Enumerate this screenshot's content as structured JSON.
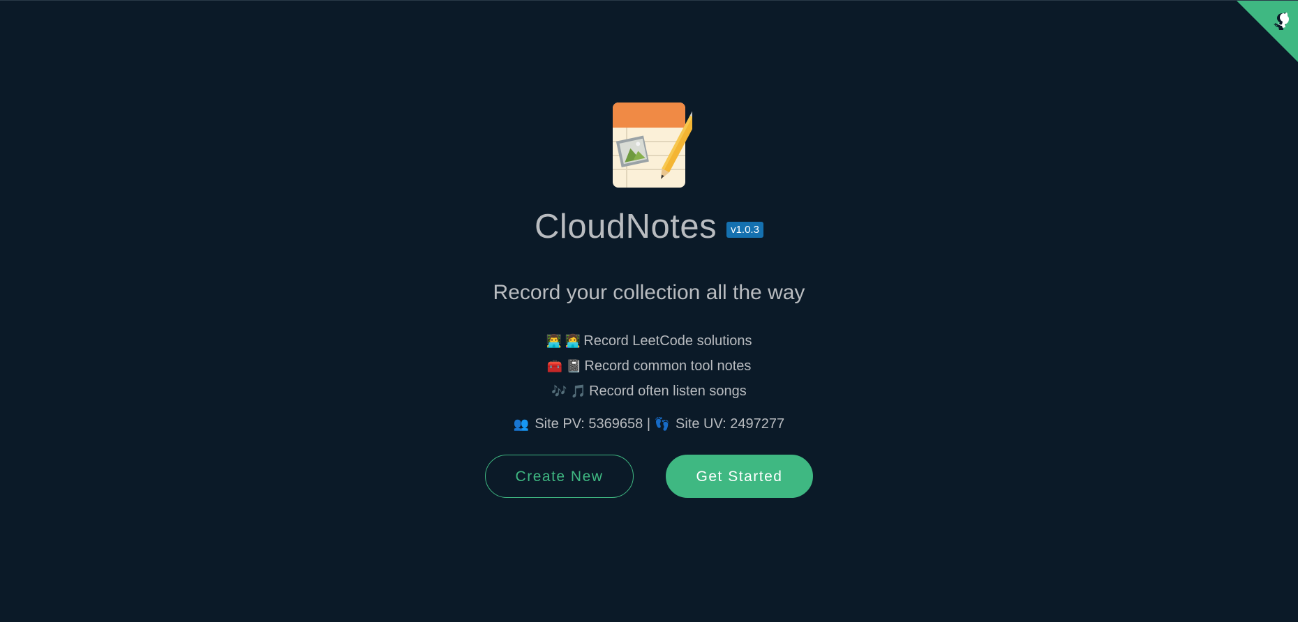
{
  "app": {
    "title": "CloudNotes",
    "version": "v1.0.3",
    "tagline": "Record your collection all the way"
  },
  "features": [
    {
      "icons": "👨‍💻 👩‍💻",
      "text": "Record LeetCode solutions"
    },
    {
      "icons": "🧰 📓",
      "text": "Record common tool notes"
    },
    {
      "icons": "🎶 🎵",
      "text": "Record often listen songs"
    }
  ],
  "stats": {
    "pv_icon": "👥",
    "pv_label": "Site PV: 5369658",
    "separator": "|",
    "uv_icon": "👣",
    "uv_label": "Site UV: 2497277"
  },
  "buttons": {
    "create_new": "Create New",
    "get_started": "Get Started"
  },
  "icons": {
    "logo": "notebook-pencil-logo-icon",
    "corner": "github-corner-icon"
  },
  "colors": {
    "background": "#0b1a28",
    "accent": "#3fb882",
    "badge": "#1571b0",
    "text": "#b9bcc0"
  }
}
